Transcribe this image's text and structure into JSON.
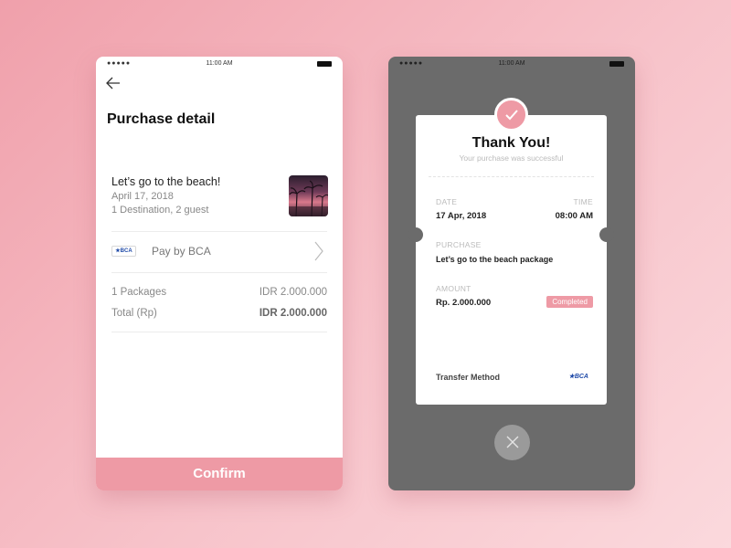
{
  "left_screen": {
    "status": {
      "time": "11:00 AM",
      "signal": "●●●●●"
    },
    "title": "Purchase detail",
    "trip": {
      "title": "Let’s go to the beach!",
      "date": "April 17, 2018",
      "guest": "1 Destination, 2 guest"
    },
    "payment": {
      "bank_badge": "★BCA",
      "label": "Pay by BCA"
    },
    "summary": {
      "packages_label": "1 Packages",
      "packages_value": "IDR 2.000.000",
      "total_label": "Total (Rp)",
      "total_value": "IDR 2.000.000"
    },
    "confirm_label": "Confirm"
  },
  "right_screen": {
    "status": {
      "time": "11:00 AM",
      "signal": "●●●●●"
    },
    "thanks": "Thank You!",
    "subtitle": "Your purchase was successful",
    "date_label": "DATE",
    "date_value": "17 Apr, 2018",
    "time_label": "TIME",
    "time_value": "08:00 AM",
    "purchase_label": "PURCHASE",
    "purchase_value": "Let’s go to the beach package",
    "amount_label": "AMOUNT",
    "amount_value": "Rp. 2.000.000",
    "status_badge": "Completed",
    "transfer_label": "Transfer Method",
    "bank_logo": "★BCA"
  },
  "colors": {
    "accent": "#ee9aa5",
    "dark_screen": "#6b6b6b"
  },
  "icons": {
    "back": "back-arrow-icon",
    "chevron": "chevron-right-icon",
    "check": "check-icon",
    "close": "close-icon"
  }
}
